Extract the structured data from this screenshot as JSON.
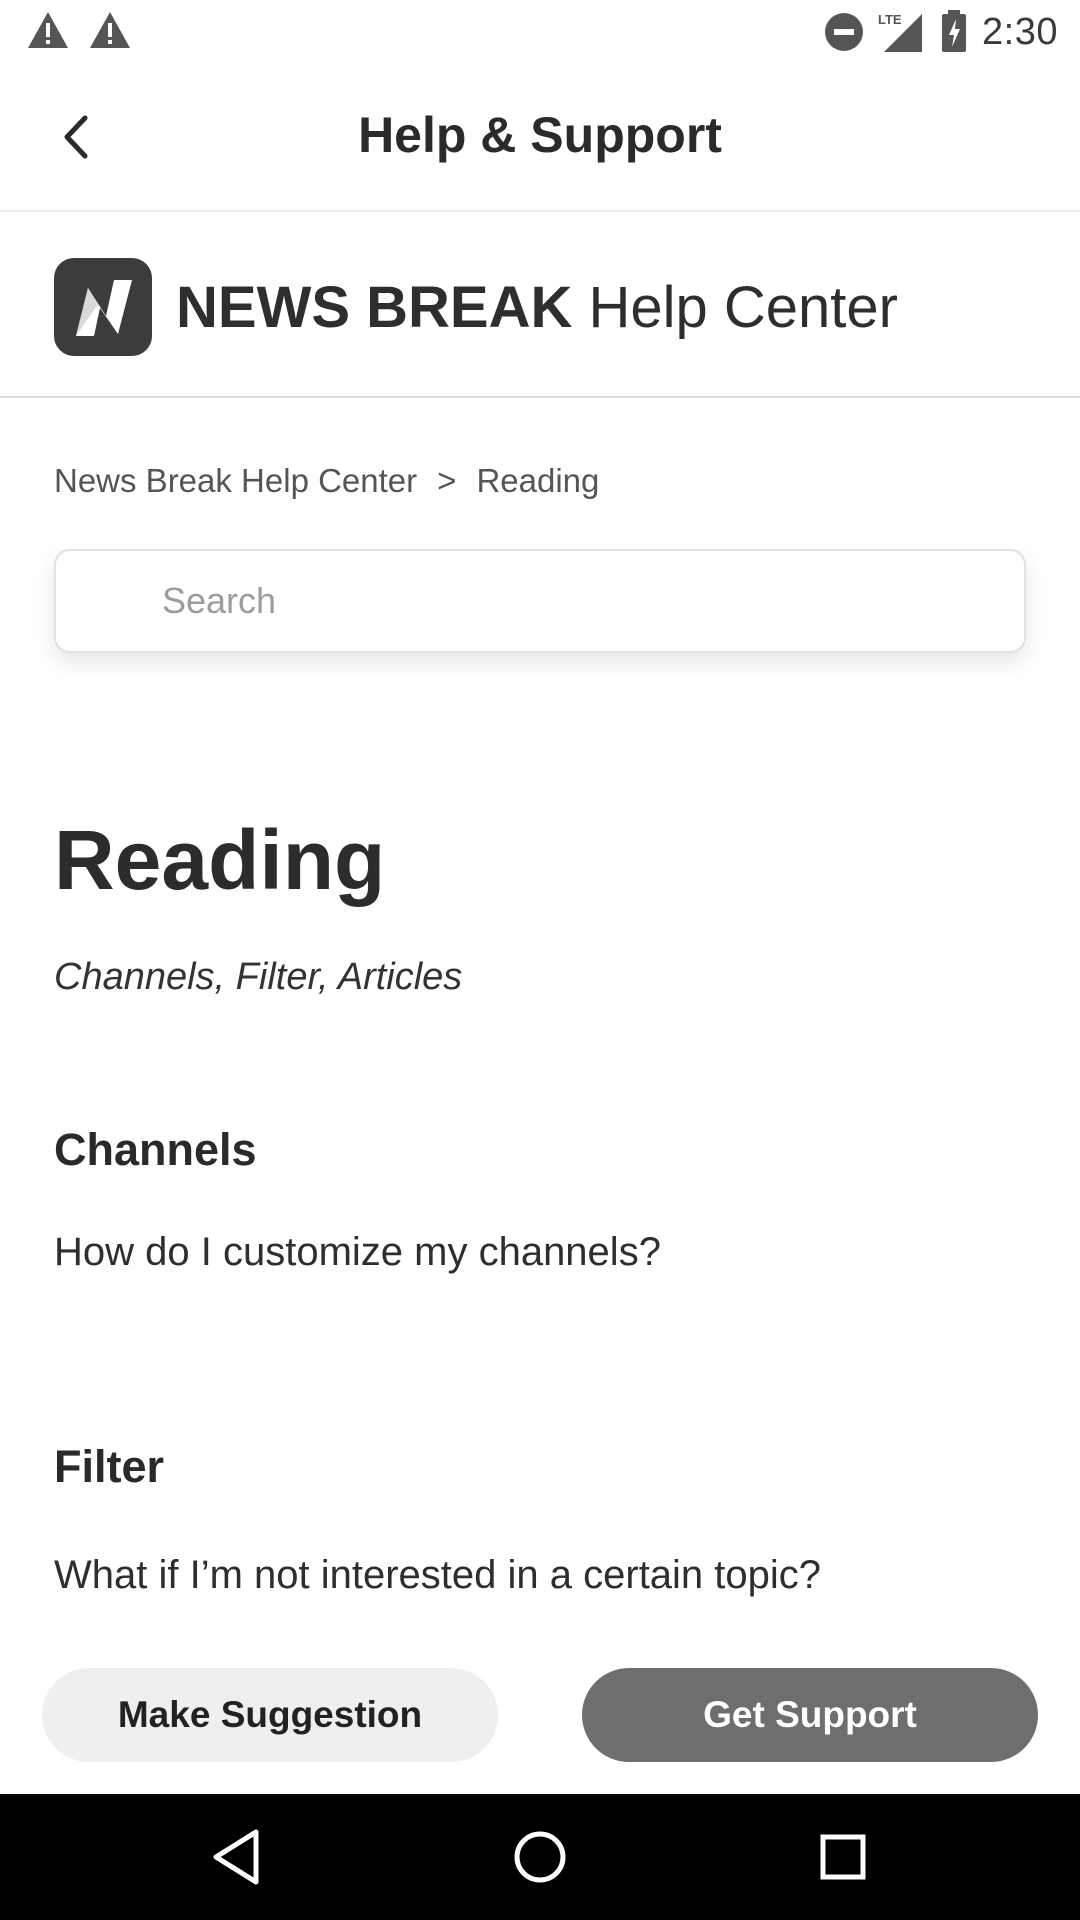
{
  "status_bar": {
    "time": "2:30",
    "icons": [
      "warning-icon",
      "warning-icon",
      "do-not-disturb-icon",
      "lte-signal-icon",
      "battery-charging-icon"
    ]
  },
  "app_bar": {
    "title": "Help & Support",
    "back_icon": "chevron-left-icon"
  },
  "brand": {
    "name": "NEWS BREAK",
    "suffix": "Help Center"
  },
  "breadcrumb": {
    "root": "News Break Help Center",
    "separator": ">",
    "current": "Reading"
  },
  "search": {
    "placeholder": "Search",
    "value": ""
  },
  "content": {
    "title": "Reading",
    "subtitle": "Channels, Filter, Articles",
    "sections": [
      {
        "heading": "Channels",
        "links": [
          "How do I customize my channels?"
        ]
      },
      {
        "heading": "Filter",
        "links": [
          "What if I’m not interested in a certain topic?"
        ]
      }
    ]
  },
  "actions": {
    "suggest_label": "Make Suggestion",
    "support_label": "Get Support"
  },
  "nav": {
    "items": [
      "back-triangle-icon",
      "home-circle-icon",
      "recents-square-icon"
    ]
  },
  "colors": {
    "support_button": "#6e6e6e",
    "suggest_button": "#efefef",
    "logo_bg": "#3c3c3c"
  }
}
